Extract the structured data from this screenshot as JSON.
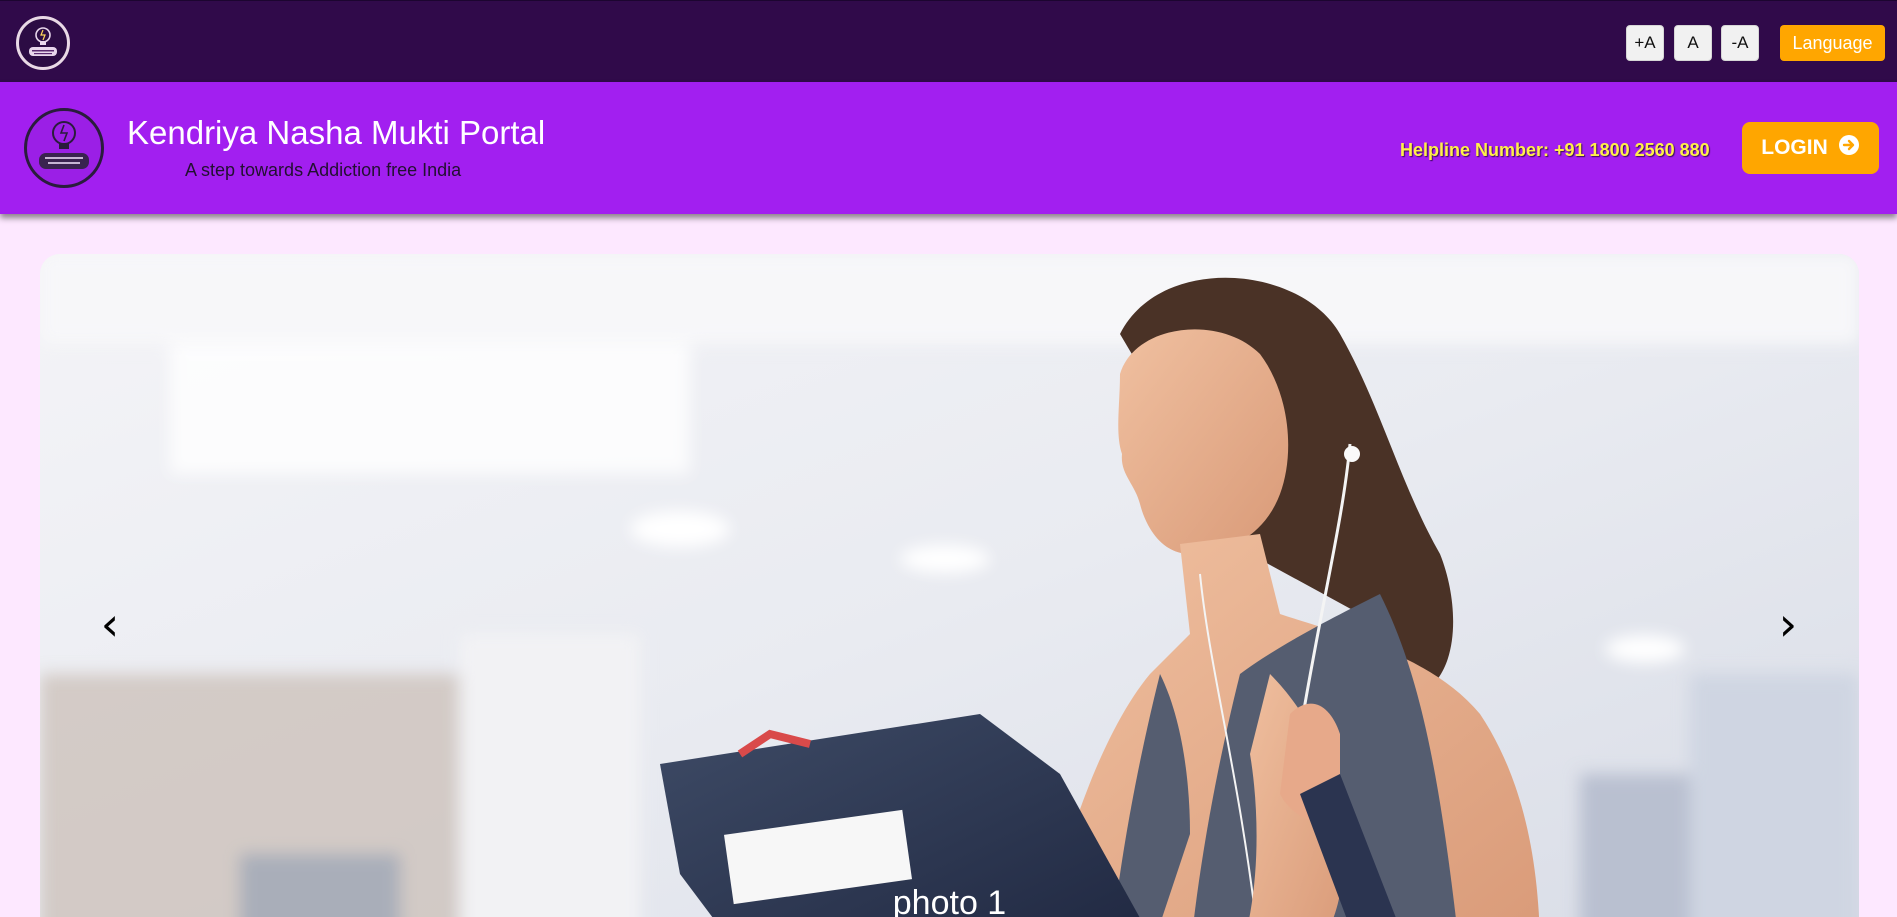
{
  "topbar": {
    "font_increase": "+A",
    "font_normal": "A",
    "font_decrease": "-A",
    "language_label": "Language"
  },
  "header": {
    "title": "Kendriya Nasha Mukti Portal",
    "tagline": "A step towards Addiction free India",
    "helpline": "Helpline Number: +91 1800 2560 880",
    "login_label": "LOGIN"
  },
  "carousel": {
    "caption": "photo 1",
    "prev_icon": "chevron-left-icon",
    "next_icon": "chevron-right-icon"
  },
  "colors": {
    "topbar_bg": "#300a4a",
    "header_bg": "#a21ff0",
    "accent": "#ffa600",
    "page_bg": "#fde8ff",
    "helpline_text": "#ffef4a"
  }
}
